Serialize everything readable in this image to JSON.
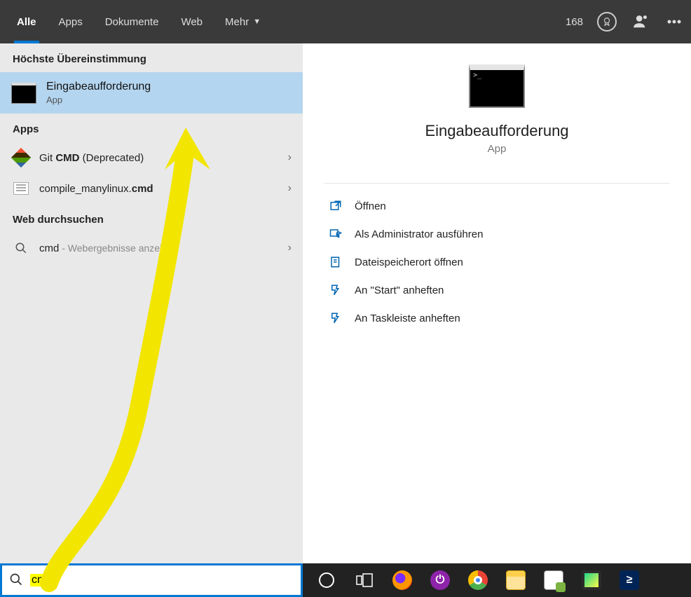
{
  "tabs": {
    "all": "Alle",
    "apps": "Apps",
    "documents": "Dokumente",
    "web": "Web",
    "more": "Mehr"
  },
  "rewards_points": "168",
  "left": {
    "best_match_header": "Höchste Übereinstimmung",
    "best_match": {
      "title": "Eingabeaufforderung",
      "subtitle": "App"
    },
    "apps_header": "Apps",
    "app1_prefix": "Git ",
    "app1_bold": "CMD",
    "app1_suffix": " (Deprecated)",
    "app2_prefix": "compile_manylinux.",
    "app2_bold": "cmd",
    "web_header": "Web durchsuchen",
    "web_query": "cmd",
    "web_suffix": " - Webergebnisse anzeigen"
  },
  "preview": {
    "title": "Eingabeaufforderung",
    "subtitle": "App",
    "actions": {
      "open": "Öffnen",
      "admin": "Als Administrator ausführen",
      "file_loc": "Dateispeicherort öffnen",
      "pin_start": "An \"Start\" anheften",
      "pin_taskbar": "An Taskleiste anheften"
    }
  },
  "search": {
    "value": "cmd"
  }
}
